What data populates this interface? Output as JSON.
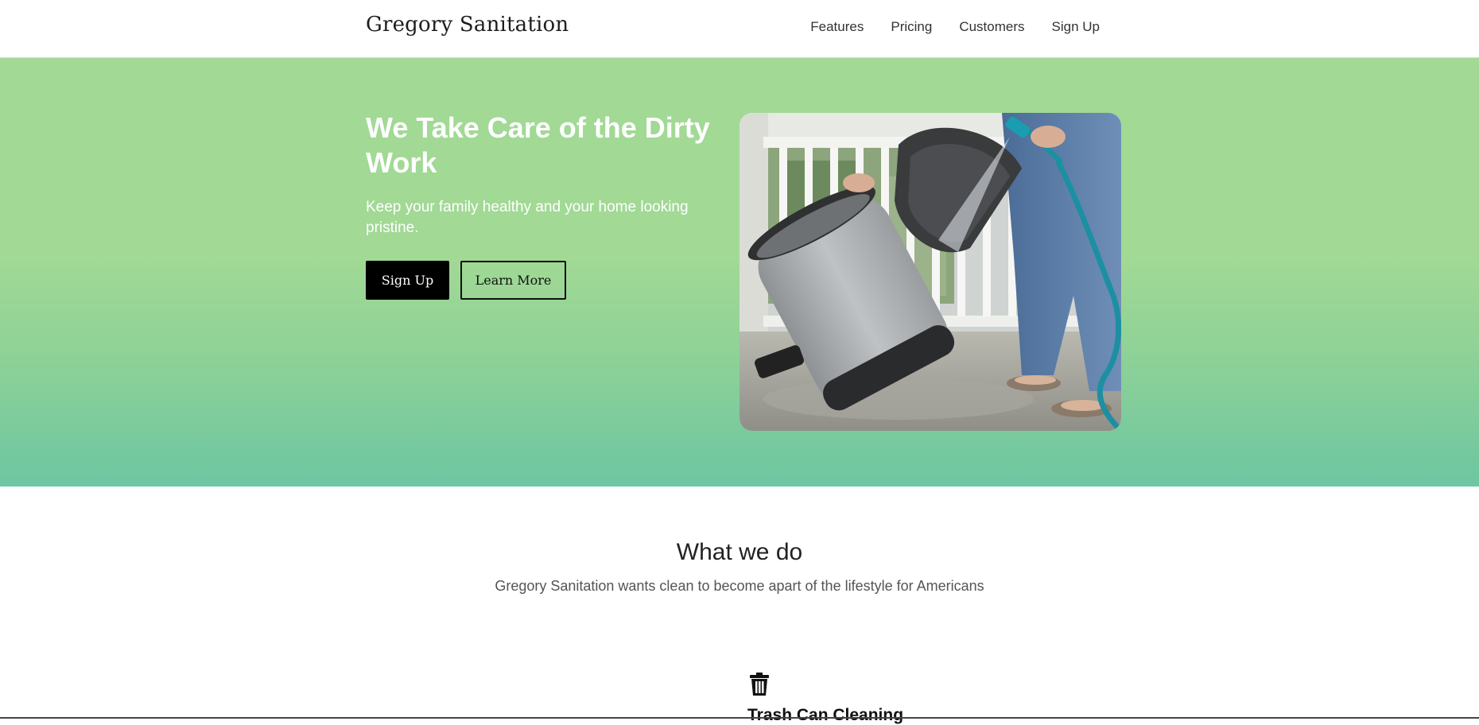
{
  "brand": {
    "name": "Gregory Sanitation"
  },
  "nav": {
    "items": [
      {
        "label": "Features"
      },
      {
        "label": "Pricing"
      },
      {
        "label": "Customers"
      },
      {
        "label": "Sign Up"
      }
    ]
  },
  "hero": {
    "title": "We Take Care of the Dirty Work",
    "subtitle": "Keep your family healthy and your home looking pristine.",
    "primary_button": "Sign Up",
    "secondary_button": "Learn More",
    "image_icon": "trash-can-cleaning-photo",
    "gradient_top_color": "#a1d995",
    "gradient_bottom_color": "#6dc6a2"
  },
  "features_section": {
    "title": "What we do",
    "subtitle": "Gregory Sanitation wants clean to become apart of the lifestyle for Americans",
    "items": [
      {
        "icon": "trash-icon",
        "title": "Trash Can Cleaning"
      }
    ]
  }
}
